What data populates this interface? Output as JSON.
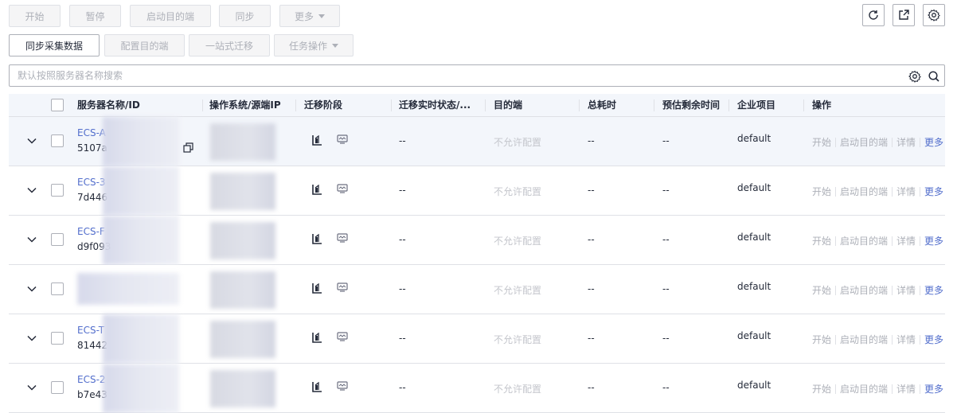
{
  "toolbar_row1": {
    "start": "开始",
    "pause": "暂停",
    "launch_target": "启动目的端",
    "sync": "同步",
    "more": "更多"
  },
  "toolbar_row2": {
    "sync_collect": "同步采集数据",
    "config_target": "配置目的端",
    "one_stop": "一站式迁移",
    "task_ops": "任务操作"
  },
  "search": {
    "placeholder": "默认按照服务器名称搜索"
  },
  "table": {
    "headers": {
      "name": "服务器名称/ID",
      "os": "操作系统/源端IP",
      "phase": "迁移阶段",
      "status": "迁移实时状态/...",
      "target": "目的端",
      "total": "总耗时",
      "remaining": "预估剩余时间",
      "project": "企业项目",
      "action": "操作"
    },
    "rows": [
      {
        "name": "ECS-A",
        "id": "5107a",
        "status": "--",
        "target": "不允许配置",
        "total": "--",
        "remaining": "--",
        "project": "default"
      },
      {
        "name": "ECS-3",
        "id": "7d446",
        "status": "--",
        "target": "不允许配置",
        "total": "--",
        "remaining": "--",
        "project": "default"
      },
      {
        "name": "ECS-F",
        "id": "d9f093",
        "status": "--",
        "target": "不允许配置",
        "total": "--",
        "remaining": "--",
        "project": "default"
      },
      {
        "name": "",
        "id": "",
        "status": "--",
        "target": "不允许配置",
        "total": "--",
        "remaining": "--",
        "project": "default"
      },
      {
        "name": "ECS-T",
        "id": "81442",
        "status": "--",
        "target": "不允许配置",
        "total": "--",
        "remaining": "--",
        "project": "default"
      },
      {
        "name": "ECS-2",
        "id": "b7e43",
        "status": "--",
        "target": "不允许配置",
        "total": "--",
        "remaining": "--",
        "project": "default"
      }
    ],
    "row_actions": {
      "start": "开始",
      "launch_target": "启动目的端",
      "detail": "详情",
      "more": "更多"
    }
  },
  "colors": {
    "link": "#526ecc",
    "header_bg": "#f3f6fb",
    "disabled_text": "#adb0b8",
    "border": "#dfe1e6"
  }
}
